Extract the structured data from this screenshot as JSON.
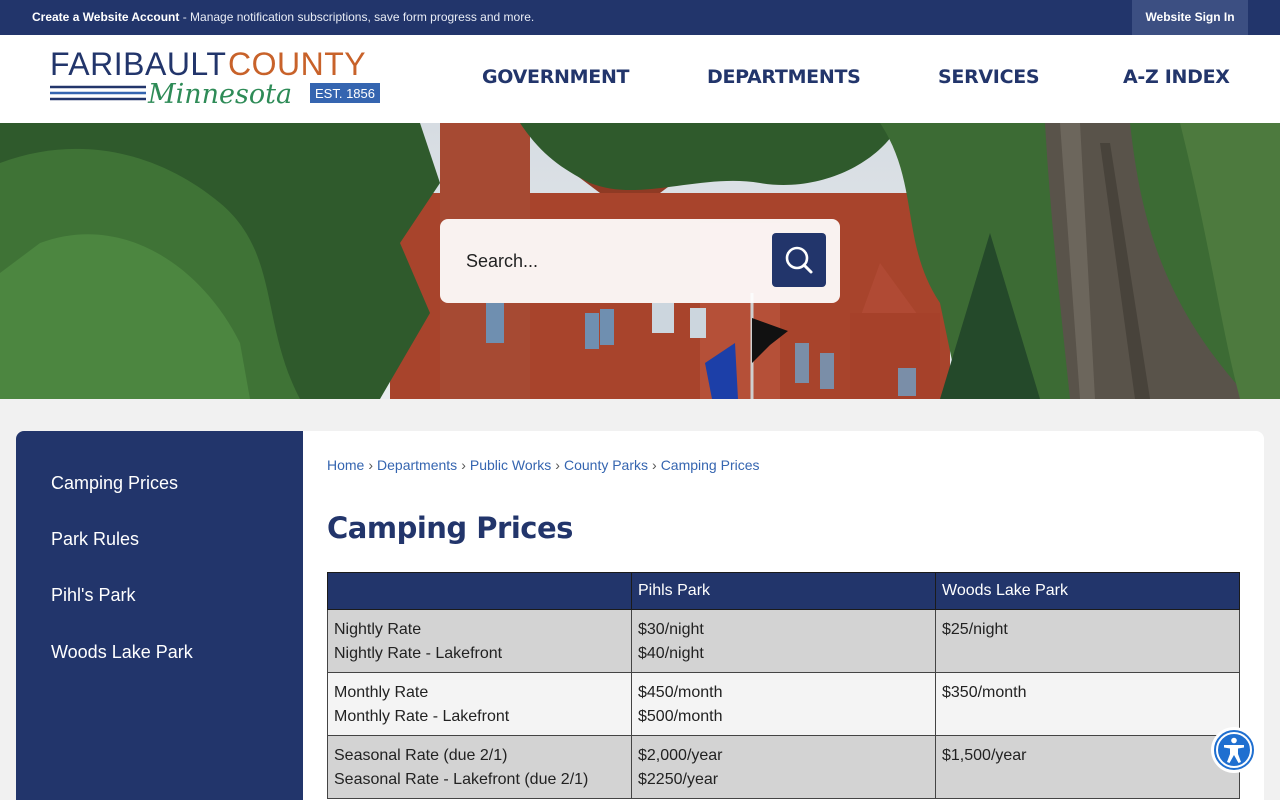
{
  "topbar": {
    "account_link": "Create a Website Account",
    "account_desc": " - Manage notification subscriptions, save form progress and more.",
    "signin": "Website Sign In"
  },
  "logo": {
    "line1": "FARIBAULT COUNTY",
    "line2": "Minnesota",
    "est": "EST. 1856",
    "colors": {
      "navy": "#22356b",
      "orange": "#c8622a",
      "green": "#2e8b57"
    }
  },
  "nav": {
    "items": [
      "GOVERNMENT",
      "DEPARTMENTS",
      "SERVICES",
      "A-Z INDEX"
    ]
  },
  "search": {
    "placeholder": "Search..."
  },
  "sidebar": {
    "items": [
      "Camping Prices",
      "Park Rules",
      "Pihl's Park",
      "Woods Lake Park"
    ]
  },
  "breadcrumb": {
    "items": [
      "Home",
      "Departments",
      "Public Works",
      "County Parks",
      "Camping Prices"
    ],
    "separator": "›"
  },
  "page": {
    "title": "Camping Prices"
  },
  "table": {
    "headers": [
      "",
      "Pihls Park",
      "Woods Lake Park"
    ],
    "rows": [
      {
        "label1": "Nightly Rate",
        "label2": "Nightly Rate - Lakefront",
        "pihl1": "$30/night",
        "pihl2": "$40/night",
        "woods": "$25/night"
      },
      {
        "label1": "Monthly Rate",
        "label2": "Monthly Rate - Lakefront",
        "pihl1": "$450/month",
        "pihl2": "$500/month",
        "woods": "$350/month"
      },
      {
        "label1": "Seasonal Rate (due 2/1)",
        "label2": "Seasonal Rate - Lakefront (due 2/1)",
        "pihl1": "$2,000/year",
        "pihl2": "$2250/year",
        "woods": "$1,500/year"
      }
    ]
  },
  "icons": {
    "search": "search-icon",
    "accessibility": "accessibility-icon"
  },
  "colors": {
    "navy": "#22356b",
    "link": "#3565b0",
    "row_shade": "#d3d3d3"
  }
}
